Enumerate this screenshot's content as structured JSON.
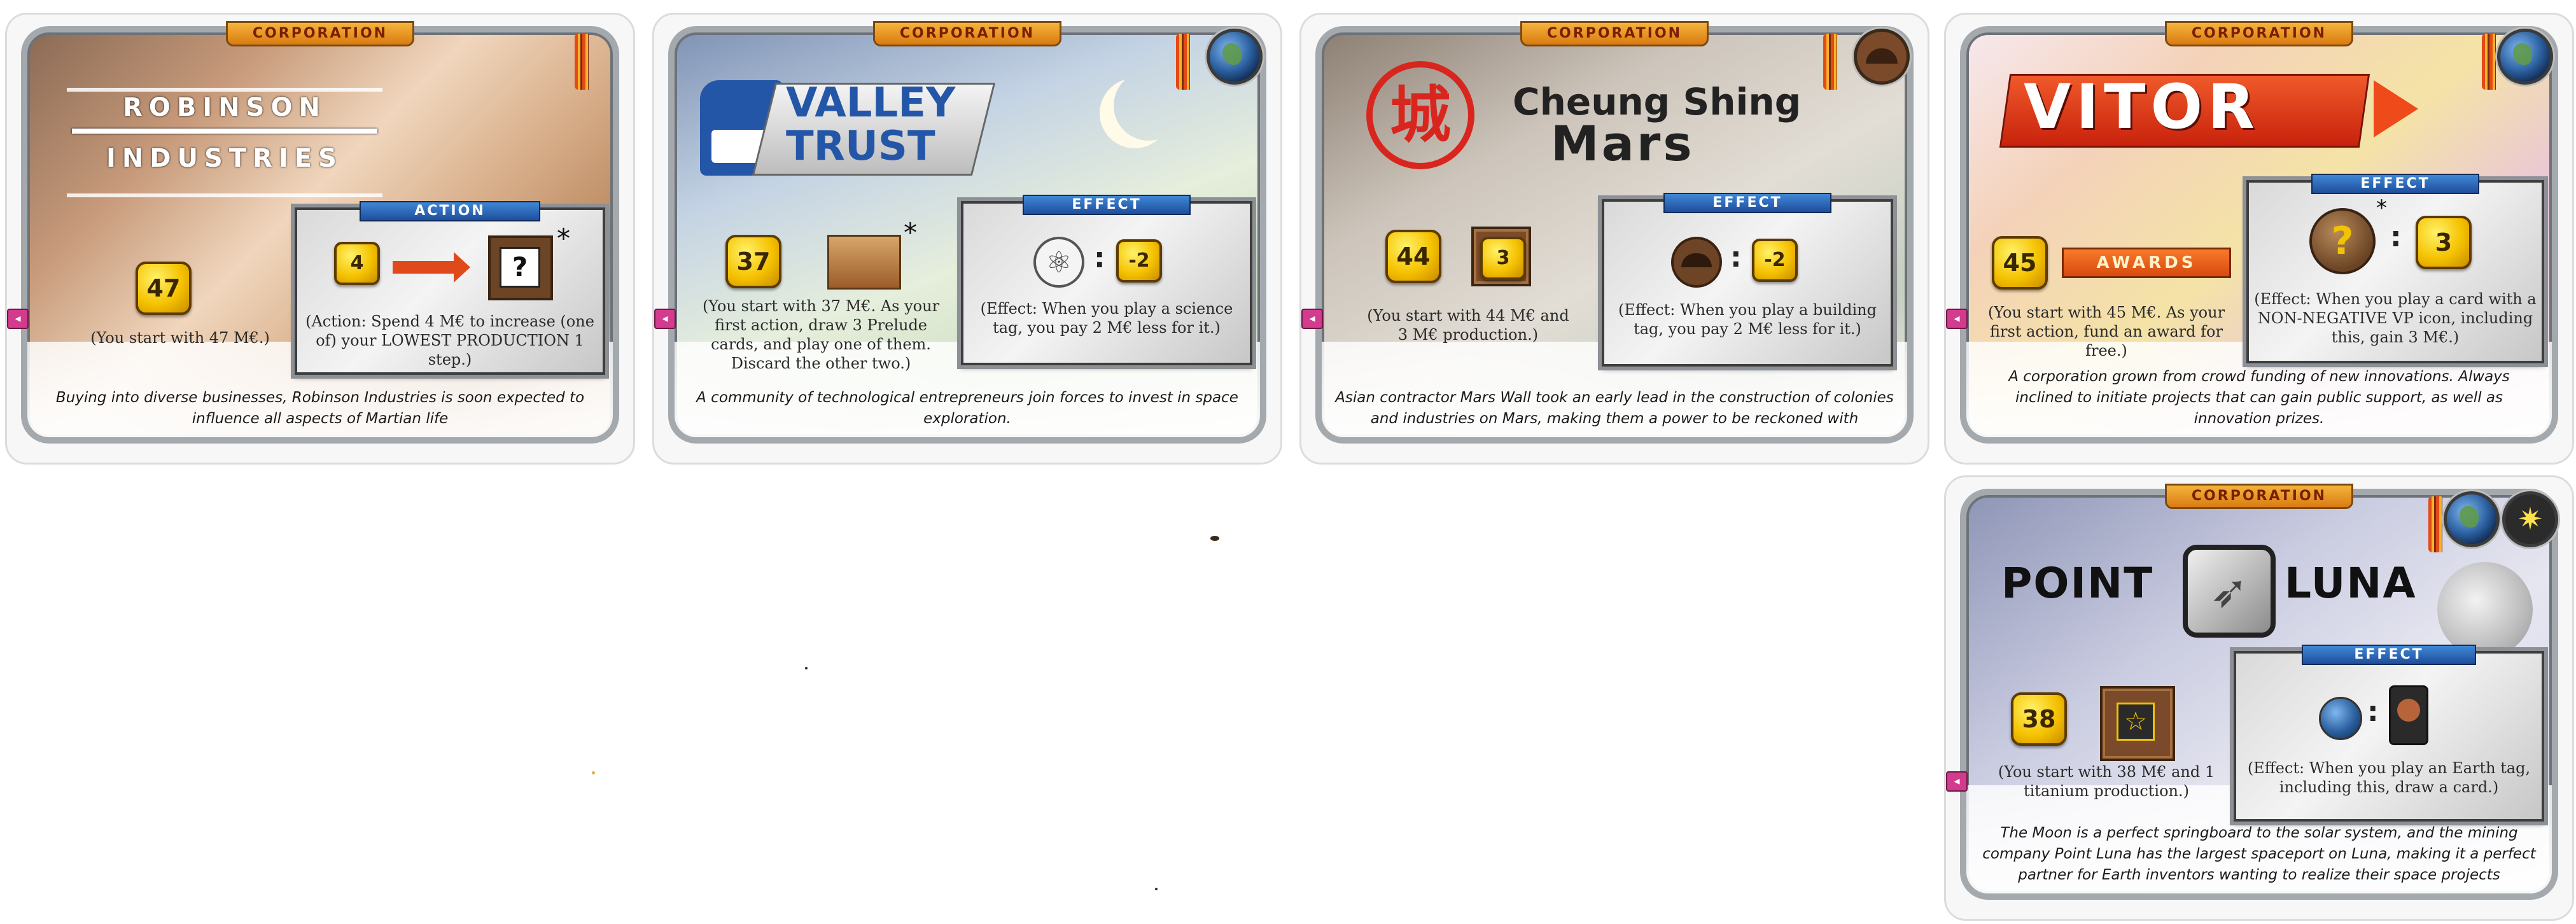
{
  "cards": [
    {
      "type_label": "CORPORATION",
      "name_line1": "ROBINSON",
      "name_line2": "INDUSTRIES",
      "starting_megacredits": "47",
      "start_text": "(You start with 47 M€.)",
      "box_title": "ACTION",
      "action_cost": "4",
      "action_symbol": "?",
      "asterisk": "*",
      "box_text": "(Action: Spend 4 M€ to increase (one of) your LOWEST PRODUCTION 1 step.)",
      "flavor": "Buying into diverse businesses, Robinson Industries is soon expected to influence all aspects of Martian life",
      "side_tag_icon": "prelude-arrow-icon"
    },
    {
      "type_label": "CORPORATION",
      "name_line1": "VALLEY",
      "name_line2": "TRUST",
      "tag_icon": "earth-icon",
      "starting_megacredits": "37",
      "asterisk": "*",
      "start_text": "(You start with 37 M€. As your first action, draw 3 Prelude cards, and play one of them. Discard the other two.)",
      "box_title": "EFFECT",
      "effect_symbol": "⚛",
      "effect_value": "-2",
      "box_text": "(Effect: When you play a science tag, you pay 2 M€ less for it.)",
      "flavor": "A community of technological entrepreneurs join forces to invest in space exploration.",
      "side_tag_icon": "prelude-arrow-icon"
    },
    {
      "type_label": "CORPORATION",
      "name_line1": "Cheung Shing",
      "name_line2": "Mars",
      "seal": "城",
      "tag_icon": "building-tag-icon",
      "starting_megacredits": "44",
      "production": "3",
      "start_text": "(You start with 44 M€ and 3 M€ production.)",
      "box_title": "EFFECT",
      "effect_value": "-2",
      "box_text": "(Effect: When you play a building tag, you pay 2 M€ less for it.)",
      "flavor": "Asian contractor Mars Wall took an early lead in the construction of colonies and industries on Mars, making them a power to be reckoned with",
      "side_tag_icon": "prelude-arrow-icon"
    },
    {
      "type_label": "CORPORATION",
      "name": "VITOR",
      "tag_icon": "earth-icon",
      "starting_megacredits": "45",
      "awards_label": "AWARDS",
      "start_text": "(You start with 45 M€. As your first action, fund an award for free.)",
      "box_title": "EFFECT",
      "effect_symbol": "?",
      "asterisk": "*",
      "effect_value": "3",
      "box_text": "(Effect: When you play a card with a NON-NEGATIVE VP icon, including this, gain 3 M€.)",
      "flavor": "A corporation grown from crowd funding of new innovations. Always inclined to initiate projects that can gain public support, as well as innovation prizes.",
      "side_tag_icon": "prelude-arrow-icon"
    },
    {
      "type_label": "CORPORATION",
      "name_left": "POINT",
      "name_right": "LUNA",
      "tag_icons": [
        "earth-icon",
        "space-tag-icon"
      ],
      "starting_megacredits": "38",
      "production_symbol": "☆",
      "start_text": "(You start with 38 M€ and 1 titanium production.)",
      "box_title": "EFFECT",
      "box_text": "(Effect: When you play an Earth tag, including this, draw a card.)",
      "flavor": "The Moon is a perfect springboard to the solar system, and the mining company Point Luna has the largest spaceport on Luna, making it a perfect partner for Earth inventors wanting to realize their space projects",
      "side_tag_icon": "prelude-arrow-icon"
    }
  ],
  "colors": {
    "corporation_tab": "#f5b43c",
    "megacredit": "#f5c200",
    "effect_label": "#1f4e9c",
    "prelude_tag": "#d33b8e",
    "vitor_red": "#e0381a",
    "cheung_red": "#d8261f",
    "valley_blue": "#2456a8"
  }
}
